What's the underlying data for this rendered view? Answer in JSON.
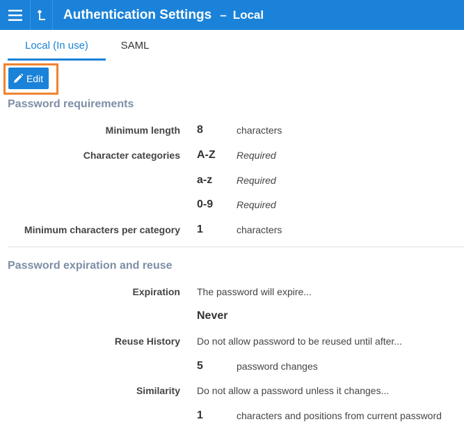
{
  "header": {
    "title": "Authentication Settings",
    "separator": "–",
    "subtitle": "Local",
    "bg_color": "#1a82d8"
  },
  "tabs": [
    {
      "label": "Local (In use)",
      "active": true
    },
    {
      "label": "SAML",
      "active": false
    }
  ],
  "toolbar": {
    "edit_label": "Edit",
    "highlight_color": "#f0822f"
  },
  "password_requirements": {
    "title": "Password requirements",
    "min_length": {
      "label": "Minimum length",
      "value": "8",
      "unit": "characters"
    },
    "character_categories": {
      "label": "Character categories",
      "items": [
        {
          "value": "A-Z",
          "status": "Required"
        },
        {
          "value": "a-z",
          "status": "Required"
        },
        {
          "value": "0-9",
          "status": "Required"
        }
      ]
    },
    "min_per_category": {
      "label": "Minimum characters per category",
      "value": "1",
      "unit": "characters"
    }
  },
  "expiration_reuse": {
    "title": "Password expiration and reuse",
    "expiration": {
      "label": "Expiration",
      "desc": "The password will expire...",
      "value": "Never"
    },
    "reuse_history": {
      "label": "Reuse History",
      "desc": "Do not allow password to be reused until after...",
      "value": "5",
      "unit": "password changes"
    },
    "similarity": {
      "label": "Similarity",
      "desc": "Do not allow a password unless it changes...",
      "value": "1",
      "unit": "characters and positions from current password"
    }
  }
}
